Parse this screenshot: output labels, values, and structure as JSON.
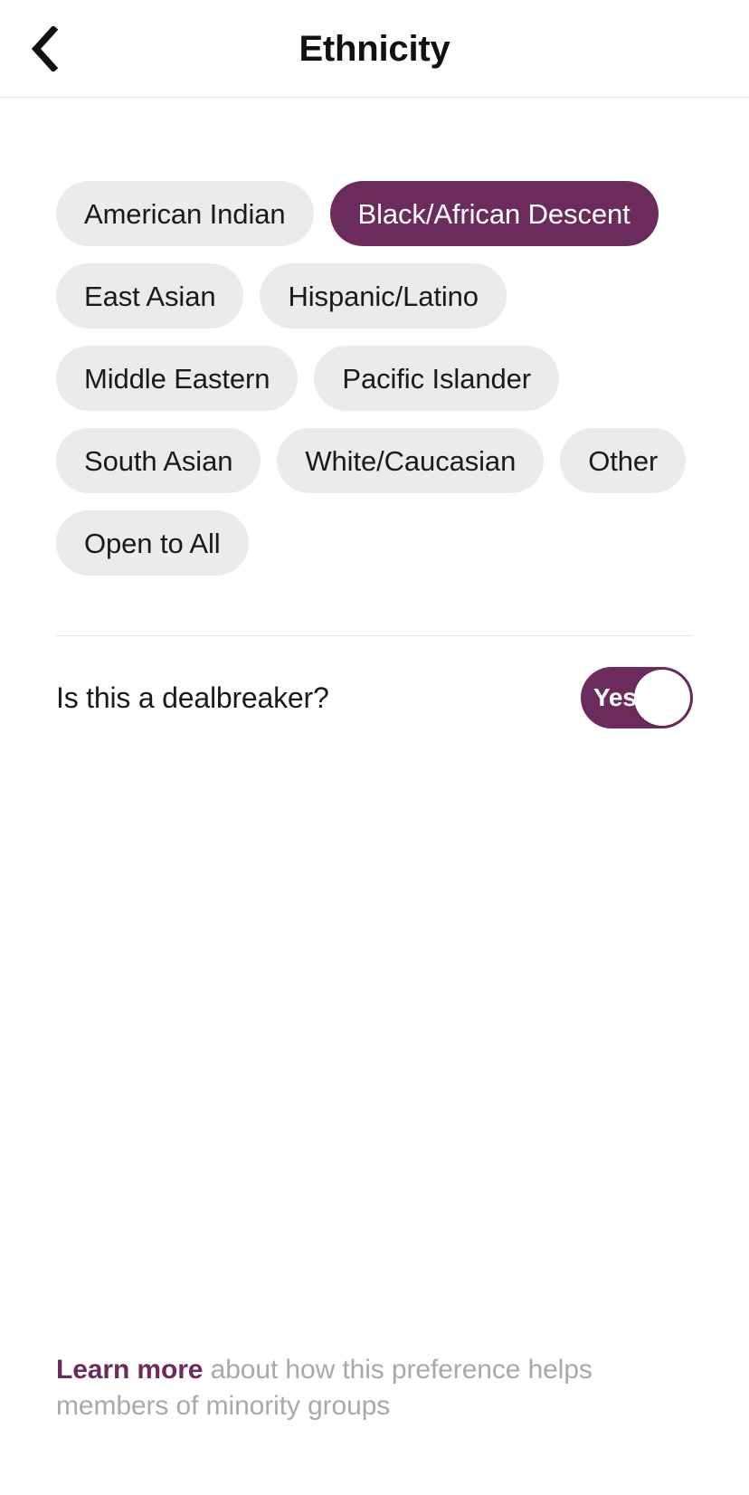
{
  "header": {
    "title": "Ethnicity",
    "back_icon": "chevron-left-icon"
  },
  "colors": {
    "accent": "#6b2b5d",
    "chip_unselected_bg": "#ebebeb",
    "chip_unselected_text": "#1a1a1c",
    "chip_selected_text": "#ffffff",
    "muted_text": "#a9a8ad",
    "divider": "#e6e6e7",
    "page_bg": "#ffffff"
  },
  "options": [
    {
      "label": "American Indian",
      "selected": false
    },
    {
      "label": "Black/African Descent",
      "selected": true
    },
    {
      "label": "East Asian",
      "selected": false
    },
    {
      "label": "Hispanic/Latino",
      "selected": false
    },
    {
      "label": "Middle Eastern",
      "selected": false
    },
    {
      "label": "Pacific Islander",
      "selected": false
    },
    {
      "label": "South Asian",
      "selected": false
    },
    {
      "label": "White/Caucasian",
      "selected": false
    },
    {
      "label": "Other",
      "selected": false
    },
    {
      "label": "Open to All",
      "selected": false
    }
  ],
  "dealbreaker": {
    "label": "Is this a dealbreaker?",
    "toggle_value": "Yes",
    "toggle_on": true
  },
  "footer": {
    "link_text": "Learn more",
    "body_text": " about how this preference helps members of minority groups"
  }
}
